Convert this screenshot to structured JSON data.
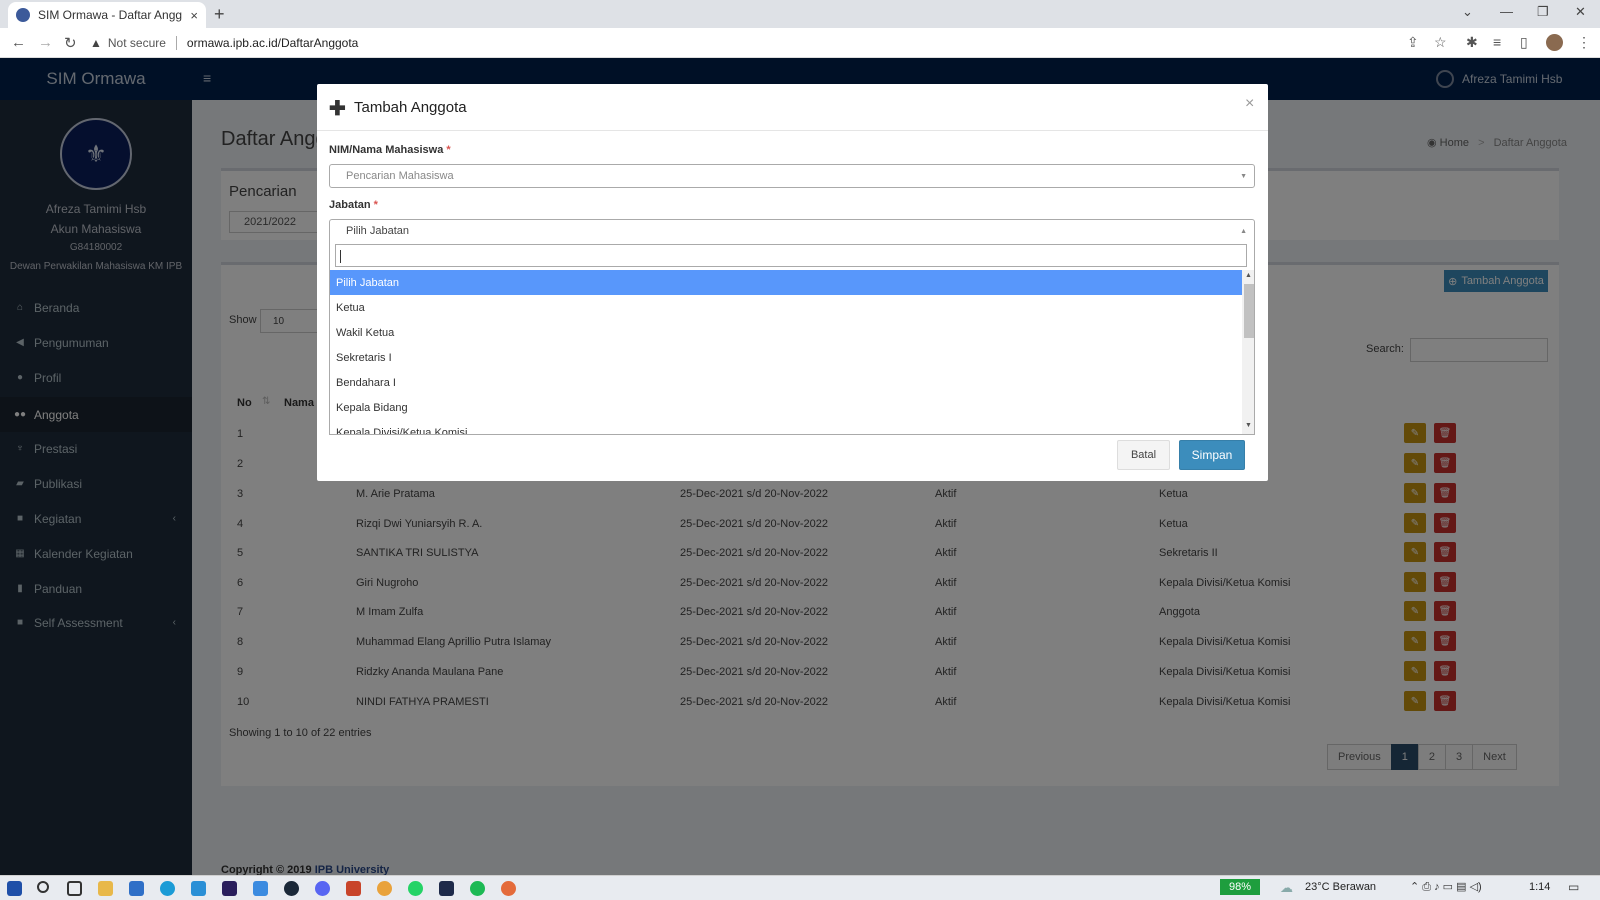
{
  "browser": {
    "tab_title": "SIM Ormawa - Daftar Anggota",
    "tab_close": "×",
    "new_tab": "+",
    "not_secure": "Not secure",
    "url": "ormawa.ipb.ac.id/DaftarAnggota"
  },
  "header": {
    "brand": "SIM Ormawa",
    "user_name": "Afreza Tamimi Hsb"
  },
  "sidebar": {
    "name": "Afreza Tamimi Hsb",
    "role": "Akun Mahasiswa",
    "nim": "G84180002",
    "org": "Dewan Perwakilan Mahasiswa KM IPB",
    "items": [
      {
        "label": "Beranda",
        "icon": "home-icon"
      },
      {
        "label": "Pengumuman",
        "icon": "bullhorn-icon"
      },
      {
        "label": "Profil",
        "icon": "user-icon"
      },
      {
        "label": "Anggota",
        "icon": "users-icon"
      },
      {
        "label": "Prestasi",
        "icon": "trophy-icon"
      },
      {
        "label": "Publikasi",
        "icon": "comments-icon"
      },
      {
        "label": "Kegiatan",
        "icon": "folder-icon"
      },
      {
        "label": "Kalender Kegiatan",
        "icon": "calendar-icon"
      },
      {
        "label": "Panduan",
        "icon": "book-icon"
      },
      {
        "label": "Self Assessment",
        "icon": "folder-icon"
      }
    ]
  },
  "page": {
    "title": "Daftar Angg",
    "breadcrumb_home": "Home",
    "breadcrumb_sep": ">",
    "breadcrumb_current": "Daftar Anggota",
    "search_box_title": "Pencarian",
    "period_value": "2021/2022",
    "add_button": "Tambah Anggota",
    "show_label": "Show",
    "show_value": "10",
    "search_label": "Search:",
    "col_no": "No",
    "col_nama": "Nama",
    "rows": [
      {
        "no": "1",
        "nama": "",
        "periode": "",
        "status": "",
        "jabatan": ""
      },
      {
        "no": "2",
        "nama": "",
        "periode": "",
        "status": "",
        "jabatan": ""
      },
      {
        "no": "3",
        "nama": "M. Arie Pratama",
        "periode": "25-Dec-2021 s/d 20-Nov-2022",
        "status": "Aktif",
        "jabatan": "Ketua"
      },
      {
        "no": "4",
        "nama": "Rizqi Dwi Yuniarsyih R. A.",
        "periode": "25-Dec-2021 s/d 20-Nov-2022",
        "status": "Aktif",
        "jabatan": "Ketua"
      },
      {
        "no": "5",
        "nama": "SANTIKA TRI SULISTYA",
        "periode": "25-Dec-2021 s/d 20-Nov-2022",
        "status": "Aktif",
        "jabatan": "Sekretaris II"
      },
      {
        "no": "6",
        "nama": "Giri Nugroho",
        "periode": "25-Dec-2021 s/d 20-Nov-2022",
        "status": "Aktif",
        "jabatan": "Kepala Divisi/Ketua Komisi"
      },
      {
        "no": "7",
        "nama": "M Imam Zulfa",
        "periode": "25-Dec-2021 s/d 20-Nov-2022",
        "status": "Aktif",
        "jabatan": "Anggota"
      },
      {
        "no": "8",
        "nama": "Muhammad Elang Aprillio Putra Islamay",
        "periode": "25-Dec-2021 s/d 20-Nov-2022",
        "status": "Aktif",
        "jabatan": "Kepala Divisi/Ketua Komisi"
      },
      {
        "no": "9",
        "nama": "Ridzky Ananda Maulana Pane",
        "periode": "25-Dec-2021 s/d 20-Nov-2022",
        "status": "Aktif",
        "jabatan": "Kepala Divisi/Ketua Komisi"
      },
      {
        "no": "10",
        "nama": "NINDI FATHYA PRAMESTI",
        "periode": "25-Dec-2021 s/d 20-Nov-2022",
        "status": "Aktif",
        "jabatan": "Kepala Divisi/Ketua Komisi"
      }
    ],
    "entries_info": "Showing 1 to 10 of 22 entries",
    "pagination": [
      "Previous",
      "1",
      "2",
      "3",
      "Next"
    ],
    "pagination_current": "1",
    "copyright_prefix": "Copyright © 2019",
    "copyright_org": "IPB University"
  },
  "modal": {
    "title": "Tambah Anggota",
    "close": "×",
    "nim_label": "NIM/Nama Mahasiswa",
    "nim_placeholder": "Pencarian Mahasiswa",
    "jabatan_label": "Jabatan",
    "required_mark": "*",
    "jabatan_selected": "Pilih Jabatan",
    "options": [
      "Pilih Jabatan",
      "Ketua",
      "Wakil Ketua",
      "Sekretaris I",
      "Bendahara I",
      "Kepala Bidang",
      "Kepala Divisi/Ketua Komisi"
    ],
    "highlighted_option": "Pilih Jabatan",
    "cancel_label": "Batal",
    "save_label": "Simpan"
  },
  "taskbar": {
    "battery": "98%",
    "weather": "23°C  Berawan",
    "time": "1:14"
  }
}
